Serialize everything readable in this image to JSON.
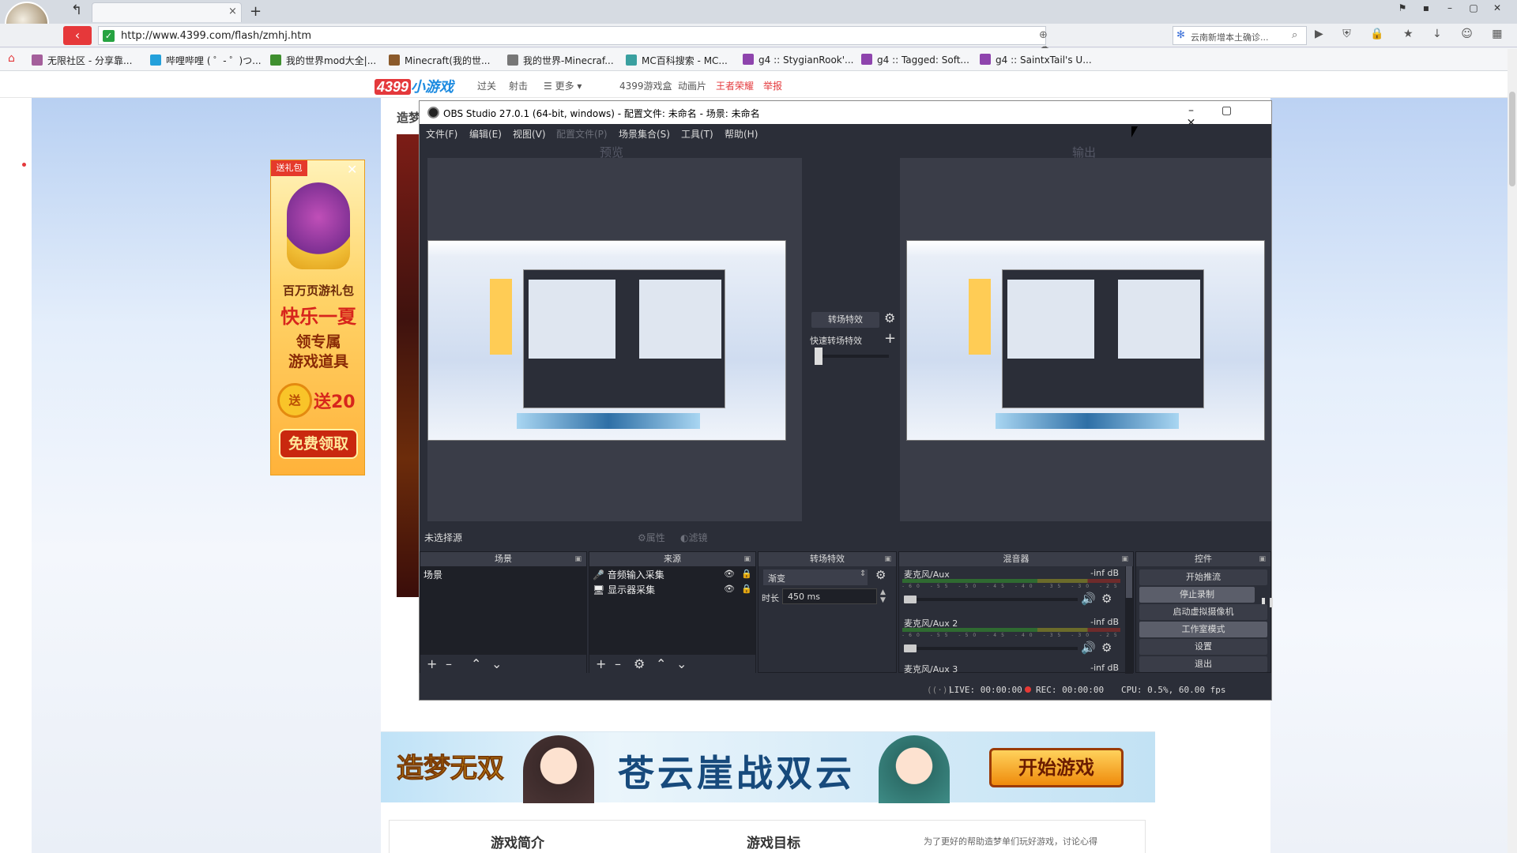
{
  "browser": {
    "tab_title": "",
    "tab_close": "×",
    "new_tab": "+",
    "nav_back": "↰",
    "back_button": "‹",
    "url": "http://www.4399.com/flash/zmhj.htm",
    "secure_glyph": "✓",
    "search_text": "云南新增本土确诊...",
    "win_controls": [
      "⚑",
      "▪",
      "–",
      "▢",
      "✕"
    ],
    "url_icons": "⊕ ☁ ▣ ★ ▾ ↻",
    "ext_icons": "▶ ⛨ 🔒 ★ ↓ ☺ ▦",
    "bookmarks": [
      {
        "label": "无限社区 - 分享靠...",
        "color": "#a45f9b"
      },
      {
        "label": "哔哩哔哩 ( ゜- ゜)つ...",
        "color": "#23a0db"
      },
      {
        "label": "我的世界mod大全|...",
        "color": "#3f8f2f"
      },
      {
        "label": "Minecraft(我的世...",
        "color": "#8b5a2b"
      },
      {
        "label": "我的世界-Minecraf...",
        "color": "#777777"
      },
      {
        "label": "MC百科搜索 - MC...",
        "color": "#3aa0a0"
      },
      {
        "label": "g4 :: StygianRook'...",
        "color": "#8e44ad"
      },
      {
        "label": "g4 :: Tagged: Soft...",
        "color": "#8e44ad"
      },
      {
        "label": "g4 :: SaintxTail's U...",
        "color": "#8e44ad"
      }
    ]
  },
  "site": {
    "logo_num": "4399",
    "logo_text": "小游戏",
    "nav": [
      "过关",
      "射击",
      "☰ 更多 ▾",
      "4399游戏盒",
      "动画片",
      "王者荣耀",
      "举报"
    ],
    "game_title": "造梦",
    "ad": {
      "badge": "送礼包",
      "close": "✕",
      "line1": "百万页游礼包",
      "line2": "快乐一夏",
      "line3": "领专属",
      "line4": "游戏道具",
      "coin": "送",
      "line5": "送20",
      "button": "免费领取"
    },
    "banner": {
      "logo": "造梦无双",
      "title": "苍云崖战双云",
      "button": "开始游戏"
    },
    "below": {
      "h1": "游戏简介",
      "h2": "游戏目标",
      "note": "为了更好的帮助造梦单们玩好游戏，讨论心得"
    }
  },
  "obs": {
    "title": "OBS Studio 27.0.1 (64-bit, windows) - 配置文件: 未命名 - 场景: 未命名",
    "win_controls": [
      "–",
      "▢",
      "✕"
    ],
    "menu": [
      {
        "label": "文件(F)",
        "disabled": false
      },
      {
        "label": "编辑(E)",
        "disabled": false
      },
      {
        "label": "视图(V)",
        "disabled": false
      },
      {
        "label": "配置文件(P)",
        "disabled": true
      },
      {
        "label": "场景集合(S)",
        "disabled": false
      },
      {
        "label": "工具(T)",
        "disabled": false
      },
      {
        "label": "帮助(H)",
        "disabled": false
      }
    ],
    "preview_label": "预览",
    "program_label": "输出",
    "transition_button": "转场特效",
    "quick_transition": "快速转场特效",
    "no_source": "未选择源",
    "properties": "⚙属性",
    "filters": "◐滤镜",
    "docks": {
      "scenes": {
        "title": "场景",
        "items": [
          "场景"
        ]
      },
      "sources": {
        "title": "来源",
        "items": [
          {
            "icon": "🎤",
            "label": "音频输入采集"
          },
          {
            "icon": "🖥",
            "label": "显示器采集"
          }
        ]
      },
      "transitions": {
        "title": "转场特效",
        "selected": "渐变",
        "duration_label": "时长",
        "duration": "450 ms"
      },
      "mixer": {
        "title": "混音器",
        "channels": [
          {
            "name": "麦克风/Aux",
            "db": "-inf dB"
          },
          {
            "name": "麦克风/Aux 2",
            "db": "-inf dB"
          },
          {
            "name": "麦克风/Aux 3",
            "db": "-inf dB"
          }
        ],
        "scale": "-60 -55 -50 -45 -40 -35 -30 -25 -20 -15 -10 -5 0"
      },
      "controls": {
        "title": "控件",
        "buttons": [
          "开始推流",
          "停止录制",
          "启动虚拟摄像机",
          "工作室模式",
          "设置",
          "退出"
        ]
      }
    },
    "status": {
      "live": "LIVE: 00:00:00",
      "rec": "REC: 00:00:00",
      "cpu": "CPU: 0.5%, 60.00 fps"
    }
  },
  "colors": {
    "obs_bg": "#2b2e38",
    "brand_red": "#e4393c",
    "accent_blue": "#1d8be0"
  }
}
